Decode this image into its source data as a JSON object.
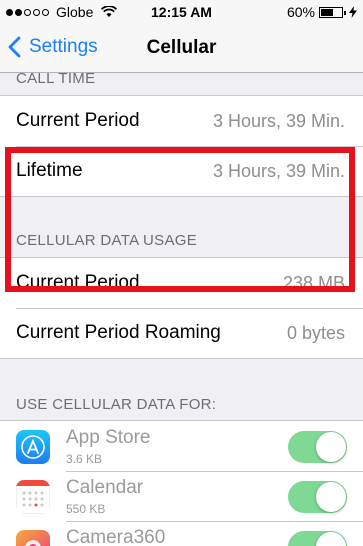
{
  "status_bar": {
    "carrier": "Globe",
    "time": "12:15 AM",
    "battery": "60%",
    "signal_bars_filled": 2,
    "signal_bars_total": 5,
    "battery_level": 0.6
  },
  "nav": {
    "back_label": "Settings",
    "title": "Cellular"
  },
  "call_time": {
    "header": "CALL TIME",
    "rows": [
      {
        "label": "Current Period",
        "value": "3 Hours, 39 Min."
      },
      {
        "label": "Lifetime",
        "value": "3 Hours, 39 Min."
      }
    ]
  },
  "data_usage": {
    "header": "CELLULAR DATA USAGE",
    "rows": [
      {
        "label": "Current Period",
        "value": "238 MB"
      },
      {
        "label": "Current Period Roaming",
        "value": "0 bytes"
      }
    ],
    "highlight_color": "#e8101a"
  },
  "use_data_for": {
    "header": "USE CELLULAR DATA FOR:",
    "apps": [
      {
        "name": "App Store",
        "size": "3.6 KB",
        "icon": "app-store-icon",
        "enabled": true
      },
      {
        "name": "Calendar",
        "size": "550 KB",
        "icon": "calendar-icon",
        "enabled": true
      },
      {
        "name": "Camera360",
        "size": "",
        "icon": "camera360-icon",
        "enabled": true
      }
    ]
  },
  "colors": {
    "accent": "#1a80f6",
    "toggle_on": "#7fd894"
  }
}
